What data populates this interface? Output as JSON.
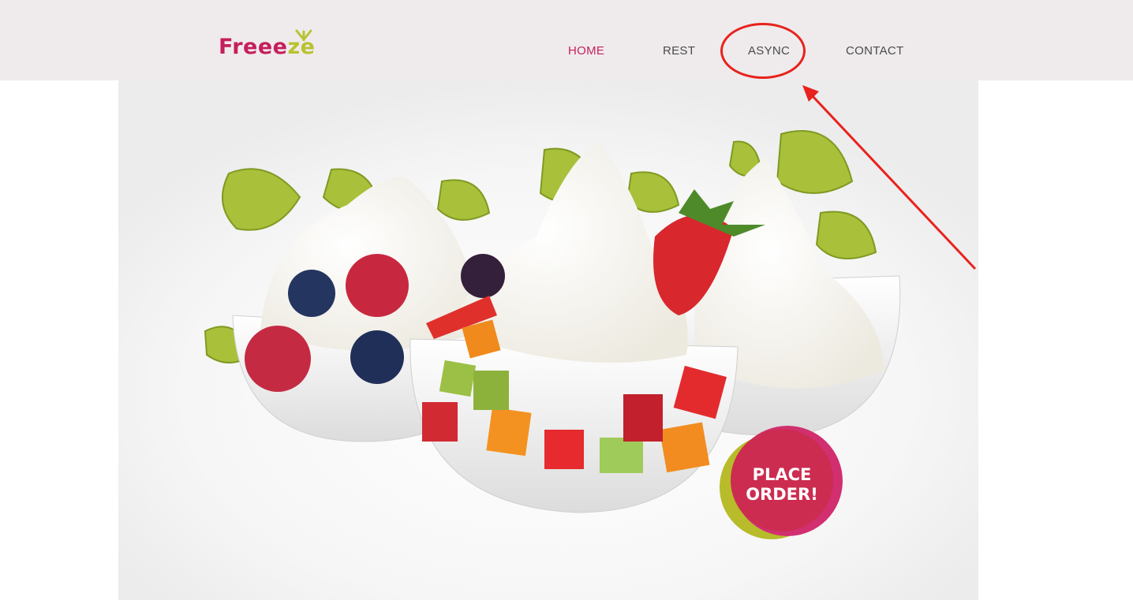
{
  "brand": {
    "logo_main": "Freee",
    "logo_accent": "ze",
    "color_primary": "#c51f5d",
    "color_accent": "#b9c232"
  },
  "nav": {
    "home": "HOME",
    "rest": "REST",
    "async": "ASYNC",
    "contact": "CONTACT",
    "active": "HOME"
  },
  "hero": {
    "image_alt": "frozen yogurt bowls with berries and fruit",
    "order_button": "PLACE\nORDER!"
  },
  "annotation": {
    "highlighted_item": "ASYNC",
    "color": "#e8221c"
  }
}
